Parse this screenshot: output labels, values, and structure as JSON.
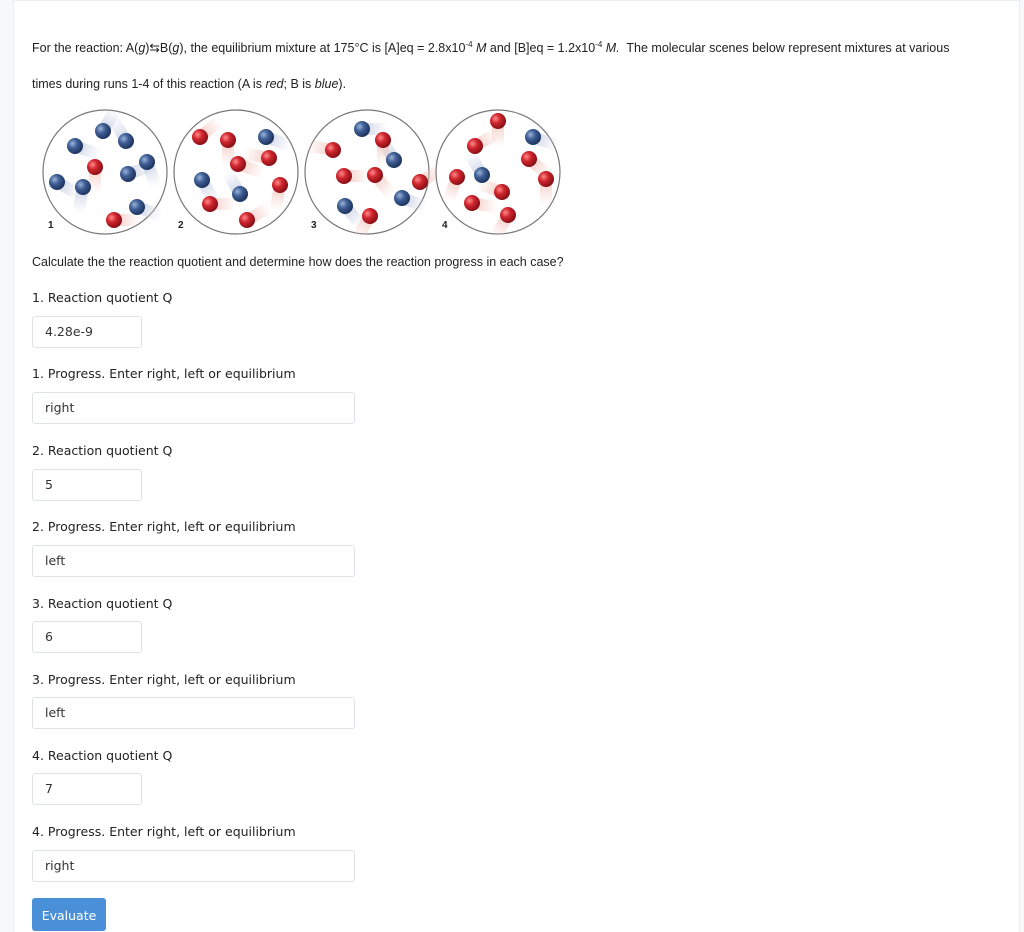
{
  "question": {
    "intro_line1_prefix": "For the reaction: A(",
    "g1": "g",
    "arrow": ")⇆B(",
    "g2": "g",
    "intro_line1_mid": "), the equilibrium mixture at 175°C is [A]eq = 2.8x10",
    "exp1": "-4",
    "unit1": " M",
    "and_b": " and [B]eq = 1.2x10",
    "exp2": "-4",
    "unit2": " M.",
    "intro_line1_suffix": "  The molecular scenes below represent mixtures at various",
    "intro_line2_prefix": "times during runs 1-4 of this reaction (A is ",
    "red_word": "red",
    "sep": "; B is ",
    "blue_word": "blue",
    "intro_line2_suffix": ").",
    "instruction": "Calculate the the reaction quotient and determine how does the reaction progress in each case?"
  },
  "colors": {
    "A_red": "#d0262e",
    "B_blue": "#3f5f95",
    "button_blue": "#4a90d9"
  },
  "scenes": [
    {
      "label": "1",
      "A_count": 2,
      "B_count": 8
    },
    {
      "label": "2",
      "A_count": 7,
      "B_count": 3
    },
    {
      "label": "3",
      "A_count": 6,
      "B_count": 4
    },
    {
      "label": "4",
      "A_count": 8,
      "B_count": 2
    }
  ],
  "form": {
    "fields": [
      {
        "label": "1. Reaction quotient Q",
        "value": "4.28e-9"
      },
      {
        "label": "1. Progress. Enter right, left or equilibrium",
        "value": "right"
      },
      {
        "label": "2. Reaction quotient Q",
        "value": "5"
      },
      {
        "label": "2. Progress. Enter right, left or equilibrium",
        "value": "left"
      },
      {
        "label": "3. Reaction quotient Q",
        "value": "6"
      },
      {
        "label": "3. Progress. Enter right, left or equilibrium",
        "value": "left"
      },
      {
        "label": "4. Reaction quotient Q",
        "value": "7"
      },
      {
        "label": "4. Progress. Enter right, left or equilibrium",
        "value": "right"
      }
    ],
    "evaluate_label": "Evaluate"
  }
}
